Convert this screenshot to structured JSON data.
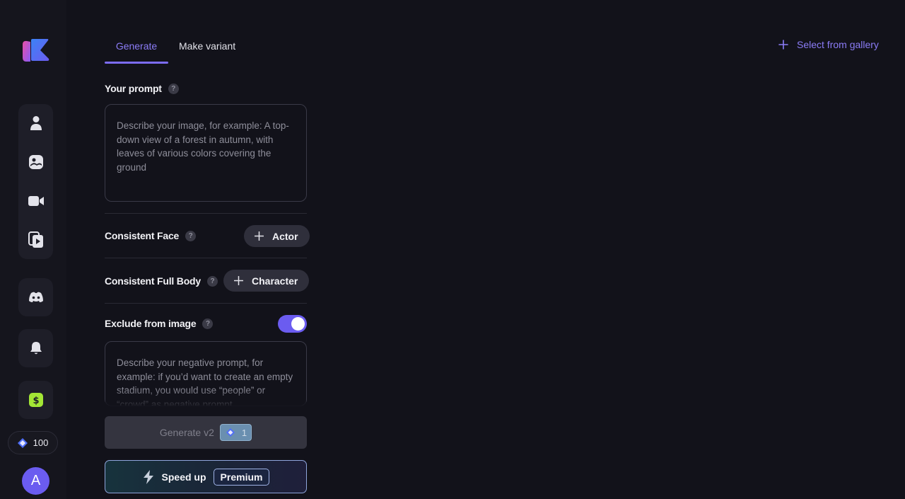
{
  "sidebar": {
    "nav": [
      {
        "icon": "person-icon"
      },
      {
        "icon": "image-icon"
      },
      {
        "icon": "video-camera-icon"
      },
      {
        "icon": "video-library-icon"
      }
    ],
    "discord_icon": "discord-icon",
    "bell_icon": "bell-icon",
    "pricing_icon": "dollar-icon",
    "credits": "100",
    "avatar_initial": "A"
  },
  "tabs": {
    "generate": "Generate",
    "variant": "Make variant"
  },
  "gallery_link": "Select from gallery",
  "prompt": {
    "label": "Your prompt",
    "placeholder": "Describe your image, for example: A top-down view of a forest in autumn, with leaves of various colors covering the ground"
  },
  "consistent_face": {
    "label": "Consistent Face",
    "button": "Actor"
  },
  "consistent_body": {
    "label": "Consistent Full Body",
    "button": "Character"
  },
  "exclude": {
    "label": "Exclude from image",
    "enabled": true,
    "placeholder": "Describe your negative prompt, for example: if you’d want to create an empty stadium, you would use “people” or “crowd” as negative prompt"
  },
  "generate_button": {
    "label": "Generate v2",
    "cost": "1"
  },
  "speed_up": {
    "label": "Speed up",
    "badge": "Premium"
  },
  "colors": {
    "accent": "#7c6cf5",
    "background": "#12121a",
    "sidebar": "#15151d",
    "pricing_icon": "#a3e635"
  }
}
